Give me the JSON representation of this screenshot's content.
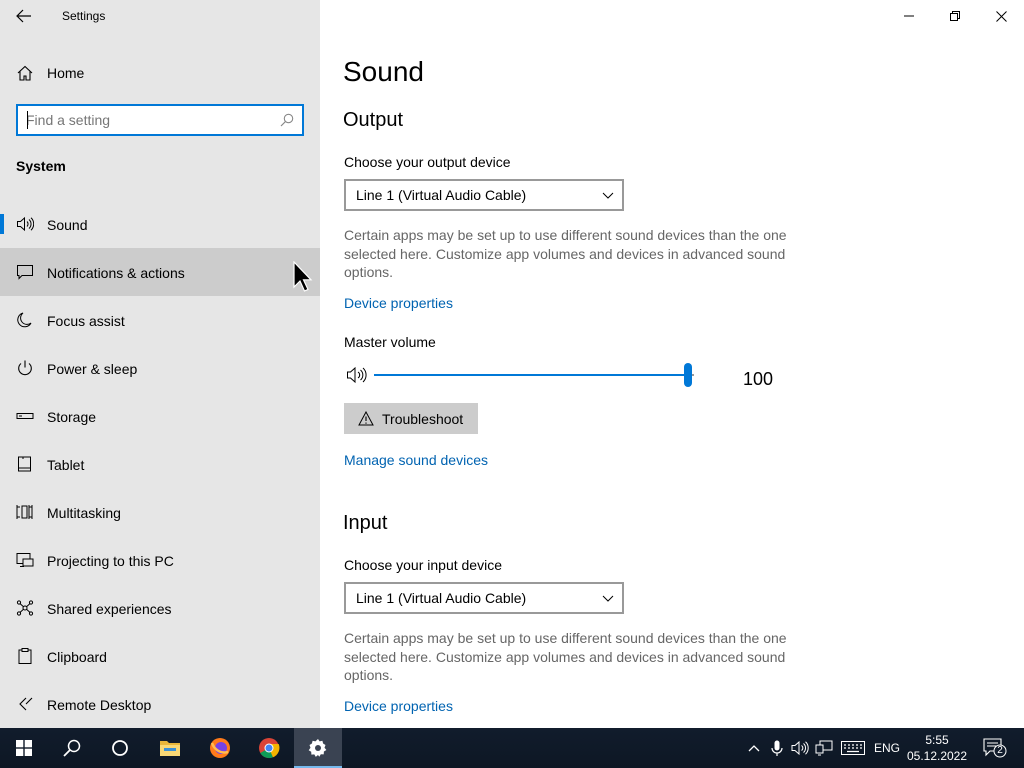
{
  "window": {
    "title": "Settings"
  },
  "sidebar": {
    "home_label": "Home",
    "search_placeholder": "Find a setting",
    "section_label": "System",
    "items": [
      {
        "label": "Sound",
        "icon": "speaker-icon",
        "selected": true
      },
      {
        "label": "Notifications & actions",
        "icon": "notification-icon",
        "hover": true
      },
      {
        "label": "Focus assist",
        "icon": "moon-icon"
      },
      {
        "label": "Power & sleep",
        "icon": "power-icon"
      },
      {
        "label": "Storage",
        "icon": "storage-icon"
      },
      {
        "label": "Tablet",
        "icon": "tablet-icon"
      },
      {
        "label": "Multitasking",
        "icon": "multitasking-icon"
      },
      {
        "label": "Projecting to this PC",
        "icon": "projecting-icon"
      },
      {
        "label": "Shared experiences",
        "icon": "shared-icon"
      },
      {
        "label": "Clipboard",
        "icon": "clipboard-icon"
      },
      {
        "label": "Remote Desktop",
        "icon": "remote-desktop-icon"
      }
    ]
  },
  "main": {
    "page_title": "Sound",
    "output": {
      "heading": "Output",
      "device_label": "Choose your output device",
      "device_value": "Line 1 (Virtual Audio Cable)",
      "description": "Certain apps may be set up to use different sound devices than the one selected here. Customize app volumes and devices in advanced sound options.",
      "device_properties": "Device properties",
      "volume_label": "Master volume",
      "volume_value": "100",
      "volume_level": 100,
      "troubleshoot": "Troubleshoot",
      "manage_devices": "Manage sound devices"
    },
    "input": {
      "heading": "Input",
      "device_label": "Choose your input device",
      "device_value": "Line 1 (Virtual Audio Cable)",
      "description": "Certain apps may be set up to use different sound devices than the one selected here. Customize app volumes and devices in advanced sound options.",
      "device_properties": "Device properties"
    }
  },
  "taskbar": {
    "language": "ENG",
    "time": "5:55",
    "date": "05.12.2022",
    "notification_count": "2"
  },
  "colors": {
    "accent": "#0078d7",
    "link": "#0063b1",
    "sidebar_bg": "#e6e6e6",
    "taskbar_bg": "#111c2c"
  }
}
